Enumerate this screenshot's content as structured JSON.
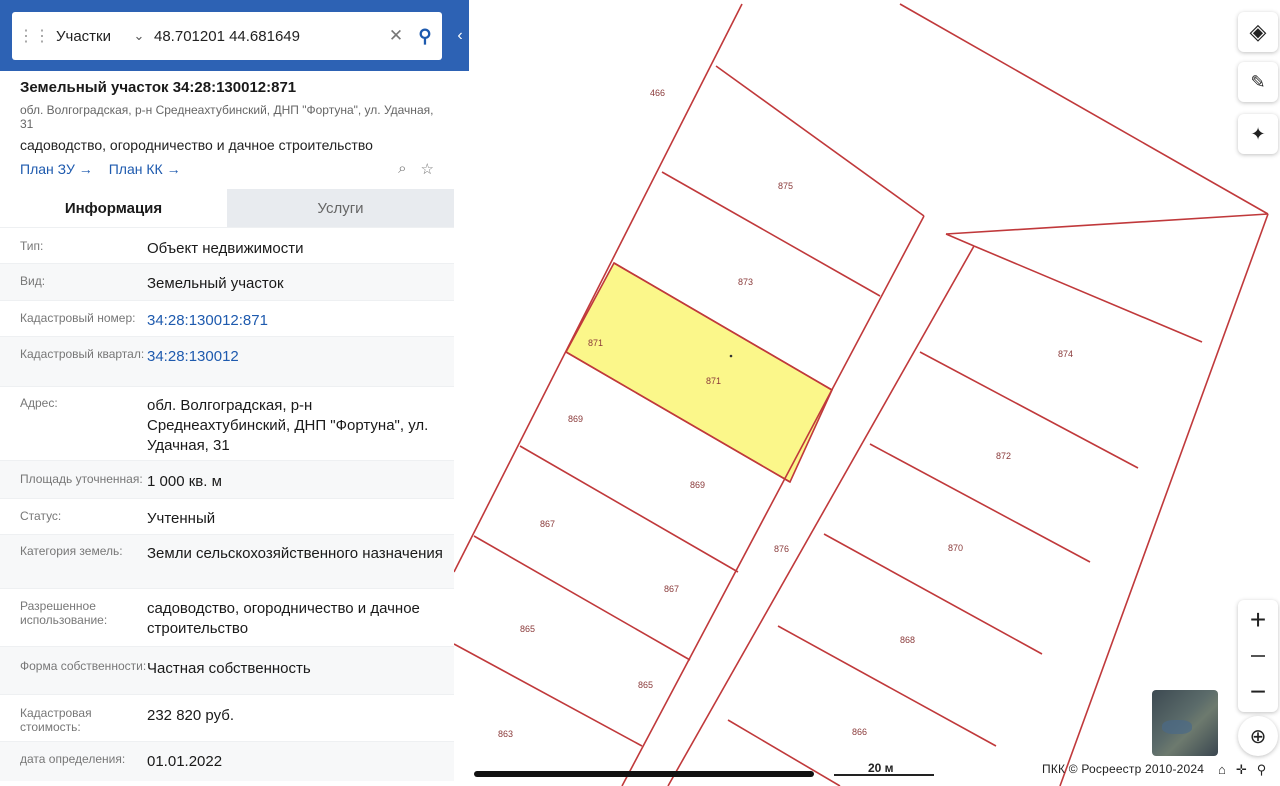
{
  "search": {
    "type_label": "Участки",
    "query": "48.701201 44.681649"
  },
  "parcel": {
    "title": "Земельный участок 34:28:130012:871",
    "address_short": "обл. Волгоградская, р-н Среднеахтубинский, ДНП \"Фортуна\", ул. Удачная, 31",
    "permitted_use": "садоводство, огородничество и дачное строительство",
    "link_plan_zu": "План ЗУ →",
    "link_plan_kk": "План КК →"
  },
  "tabs": [
    {
      "label": "Информация",
      "active": true
    },
    {
      "label": "Услуги",
      "active": false
    }
  ],
  "rows": [
    {
      "label": "Тип:",
      "value": "Объект недвижимости",
      "link": false
    },
    {
      "label": "Вид:",
      "value": "Земельный участок",
      "link": false
    },
    {
      "label": "Кадастровый номер:",
      "value": "34:28:130012:871",
      "link": true
    },
    {
      "label": "Кадастровый квартал:",
      "value": "34:28:130012",
      "link": true
    },
    {
      "label": "Адрес:",
      "value": "обл. Волгоградская, р-н Среднеахтубинский, ДНП \"Фортуна\", ул. Удачная, 31",
      "link": false
    },
    {
      "label": "Площадь уточненная:",
      "value": "1 000 кв. м",
      "link": false
    },
    {
      "label": "Статус:",
      "value": "Учтенный",
      "link": false
    },
    {
      "label": "Категория земель:",
      "value": "Земли сельскохозяйственного назначения",
      "link": false
    },
    {
      "label": "Разрешенное использование:",
      "value": "садоводство, огородничество и дачное строительство",
      "link": false
    },
    {
      "label": "Форма собственности:",
      "value": "Частная собственность",
      "link": false
    },
    {
      "label": "Кадастровая стоимость:",
      "value": "232 820 руб.",
      "link": false
    },
    {
      "label": "дата определения:",
      "value": "01.01.2022",
      "link": false
    }
  ],
  "map": {
    "parcel_labels": [
      "466",
      "875",
      "873",
      "871",
      "871",
      "874",
      "869",
      "872",
      "869",
      "867",
      "876",
      "870",
      "867",
      "865",
      "868",
      "865",
      "863",
      "866",
      "863",
      "876"
    ],
    "selected_fill": "#fbf78a",
    "line_color": "#c0393b",
    "scale_label": "20 м",
    "attribution": "ПКК © Росреестр 2010-2024"
  },
  "colors": {
    "header_blue": "#2d62b4",
    "link_blue": "#1e5aae"
  },
  "icons": [
    "grid-icon",
    "chevron-down-icon",
    "clear-icon",
    "search-icon",
    "chevron-left-icon",
    "layers-icon",
    "ruler-icon",
    "locate-icon",
    "plus-icon",
    "minus-icon",
    "compass-icon",
    "zoom-search-icon",
    "star-icon"
  ]
}
